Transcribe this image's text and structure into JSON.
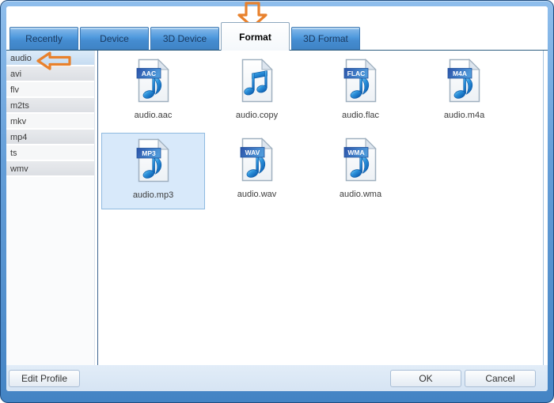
{
  "tabs": [
    {
      "label": "Recently",
      "active": false
    },
    {
      "label": "Device",
      "active": false
    },
    {
      "label": "3D Device",
      "active": false
    },
    {
      "label": "Format",
      "active": true
    },
    {
      "label": "3D Format",
      "active": false
    }
  ],
  "sidebar": {
    "items": [
      {
        "label": "audio",
        "selected": true
      },
      {
        "label": "avi",
        "selected": false
      },
      {
        "label": "flv",
        "selected": false
      },
      {
        "label": "m2ts",
        "selected": false
      },
      {
        "label": "mkv",
        "selected": false
      },
      {
        "label": "mp4",
        "selected": false
      },
      {
        "label": "ts",
        "selected": false
      },
      {
        "label": "wmv",
        "selected": false
      }
    ]
  },
  "grid": {
    "rows": [
      [
        {
          "label": "audio.aac",
          "banner": "AAC",
          "note": "single",
          "selected": false
        },
        {
          "label": "audio.copy",
          "banner": null,
          "note": "double",
          "selected": false
        },
        {
          "label": "audio.flac",
          "banner": "FLAC",
          "note": "single",
          "selected": false
        },
        {
          "label": "audio.m4a",
          "banner": "M4A",
          "note": "single",
          "selected": false
        }
      ],
      [
        {
          "label": "audio.mp3",
          "banner": "MP3",
          "note": "single",
          "selected": true
        },
        {
          "label": "audio.wav",
          "banner": "WAV",
          "note": "single",
          "selected": false
        },
        {
          "label": "audio.wma",
          "banner": "WMA",
          "note": "single",
          "selected": false
        }
      ]
    ]
  },
  "footer": {
    "edit_profile_label": "Edit Profile",
    "ok_label": "OK",
    "cancel_label": "Cancel"
  },
  "annotations": {
    "down_arrow_target": "Format",
    "left_arrow_target": "audio",
    "arrow_color": "#e8812c"
  },
  "colors": {
    "frame_blue": "#4484c4",
    "tab_blue": "#509ade",
    "selection_blue": "#d8e9fa",
    "panel_border": "#3c6590",
    "footer_bg": "#d6e4f3"
  }
}
